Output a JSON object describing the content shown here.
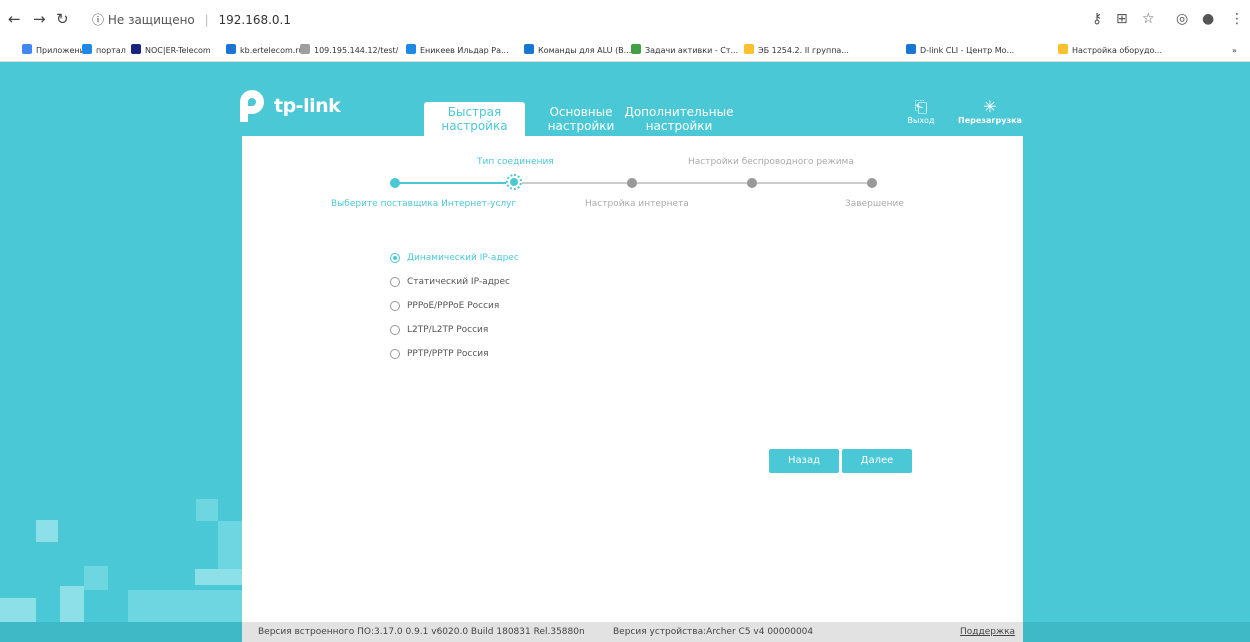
{
  "browser": {
    "insecure_label": "Не защищено",
    "url": "192.168.0.1",
    "bookmarks": [
      {
        "label": "Приложения",
        "color": "#4285f4"
      },
      {
        "label": "портал",
        "color": "#1e88e5"
      },
      {
        "label": "NOC|ER-Telecom",
        "color": "#1a237e"
      },
      {
        "label": "kb.ertelecom.ru",
        "color": "#1976d2"
      },
      {
        "label": "109.195.144.12/test/",
        "color": "#9e9e9e"
      },
      {
        "label": "Еникеев Ильдар Ра...",
        "color": "#1e88e5"
      },
      {
        "label": "Команды для ALU (В...",
        "color": "#1976d2"
      },
      {
        "label": "Задачи активки - Ст...",
        "color": "#43a047"
      },
      {
        "label": "ЭБ 1254.2. II группа...",
        "color": "#fbc02d"
      },
      {
        "label": "D-link CLI - Центр Мо...",
        "color": "#1976d2"
      },
      {
        "label": "Настройка оборудо...",
        "color": "#fbc02d"
      }
    ],
    "more_label": "»"
  },
  "router": {
    "logo_text": "tp-link",
    "tabs": [
      {
        "line1": "Быстрая",
        "line2": "настройка"
      },
      {
        "line1": "Основные",
        "line2": "настройки"
      },
      {
        "line1": "Дополнительные",
        "line2": "настройки"
      }
    ],
    "logout_label": "Выход",
    "reboot_label": "Перезагрузка",
    "steps_top": [
      "Тип соединения",
      "Настройки беспроводного режима"
    ],
    "steps_bottom": [
      "Выберите поставщика Интернет-услуг",
      "Настройка интернета",
      "Завершение"
    ],
    "options": [
      "Динамический IP-адрес",
      "Статический IP-адрес",
      "PPPoE/PPPoE Россия",
      "L2TP/L2TP Россия",
      "PPTP/PPTP Россия"
    ],
    "selected_option": "Динамический IP-адрес",
    "back_label": "Назад",
    "next_label": "Далее",
    "firmware": "Версия встроенного ПО:3.17.0 0.9.1 v6020.0 Build 180831 Rel.35880n",
    "hardware": "Версия устройства:Archer C5 v4 00000004",
    "support_label": "Поддержка",
    "colors": {
      "accent": "#4bc8d5",
      "panel": "#ffffff"
    }
  }
}
